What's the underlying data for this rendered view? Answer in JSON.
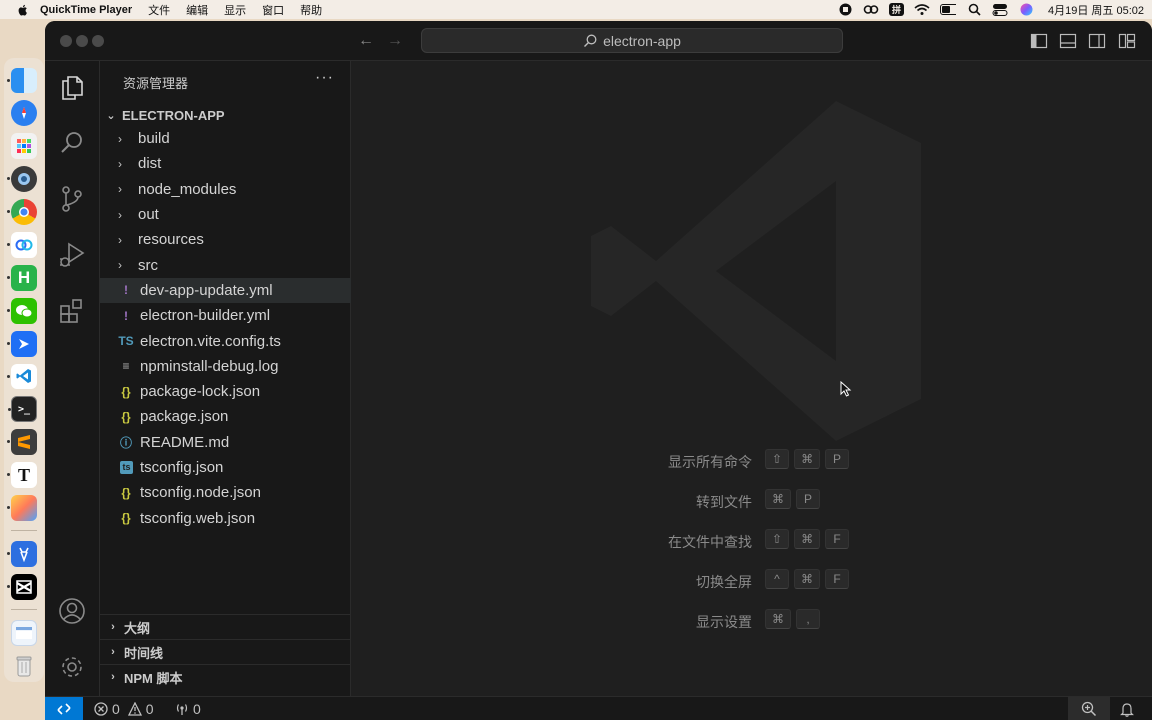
{
  "menubar": {
    "app_name": "QuickTime Player",
    "menus": [
      "文件",
      "编辑",
      "显示",
      "窗口",
      "帮助"
    ],
    "clock": "4月19日 周五 05:02",
    "input_method": "拼"
  },
  "dock": {
    "apps": [
      "Finder",
      "Safari",
      "Launchpad",
      "Screen Recorder",
      "Chrome",
      "Baidu Netdisk",
      "HBuilder",
      "WeChat",
      "Feishu",
      "VS Code",
      "Terminal",
      "Sublime Text",
      "Typora",
      "Draw",
      "Deer App",
      "CapCut",
      "Preview",
      "Trash"
    ]
  },
  "titlebar": {
    "search_text": "electron-app"
  },
  "sidebar": {
    "title": "资源管理器",
    "more": "···",
    "project": "ELECTRON-APP",
    "tree": [
      {
        "type": "folder",
        "name": "build"
      },
      {
        "type": "folder",
        "name": "dist"
      },
      {
        "type": "folder",
        "name": "node_modules"
      },
      {
        "type": "folder",
        "name": "out"
      },
      {
        "type": "folder",
        "name": "resources"
      },
      {
        "type": "folder",
        "name": "src"
      },
      {
        "type": "file",
        "icon": "!",
        "name": "dev-app-update.yml",
        "selected": true
      },
      {
        "type": "file",
        "icon": "!",
        "name": "electron-builder.yml"
      },
      {
        "type": "file",
        "icon": "TS",
        "name": "electron.vite.config.ts"
      },
      {
        "type": "file",
        "icon": "≡",
        "name": "npminstall-debug.log"
      },
      {
        "type": "file",
        "icon": "{}",
        "name": "package-lock.json"
      },
      {
        "type": "file",
        "icon": "{}",
        "name": "package.json"
      },
      {
        "type": "file",
        "icon": "ⓘ",
        "name": "README.md"
      },
      {
        "type": "file",
        "icon": "ts",
        "name": "tsconfig.json"
      },
      {
        "type": "file",
        "icon": "{}",
        "name": "tsconfig.node.json"
      },
      {
        "type": "file",
        "icon": "{}",
        "name": "tsconfig.web.json"
      }
    ],
    "sections": [
      "大纲",
      "时间线",
      "NPM 脚本"
    ]
  },
  "editor": {
    "shortcuts": [
      {
        "label": "显示所有命令",
        "keys": [
          "⇧",
          "⌘",
          "P"
        ]
      },
      {
        "label": "转到文件",
        "keys": [
          "⌘",
          "P"
        ]
      },
      {
        "label": "在文件中查找",
        "keys": [
          "⇧",
          "⌘",
          "F"
        ]
      },
      {
        "label": "切换全屏",
        "keys": [
          "^",
          "⌘",
          "F"
        ]
      },
      {
        "label": "显示设置",
        "keys": [
          "⌘",
          ","
        ]
      }
    ]
  },
  "statusbar": {
    "errors": "0",
    "warnings": "0",
    "ports": "0"
  },
  "colors": {
    "accent": "#0078d4",
    "yaml_icon": "#a074c4",
    "json_icon": "#cbcb41",
    "ts_icon": "#519aba"
  }
}
